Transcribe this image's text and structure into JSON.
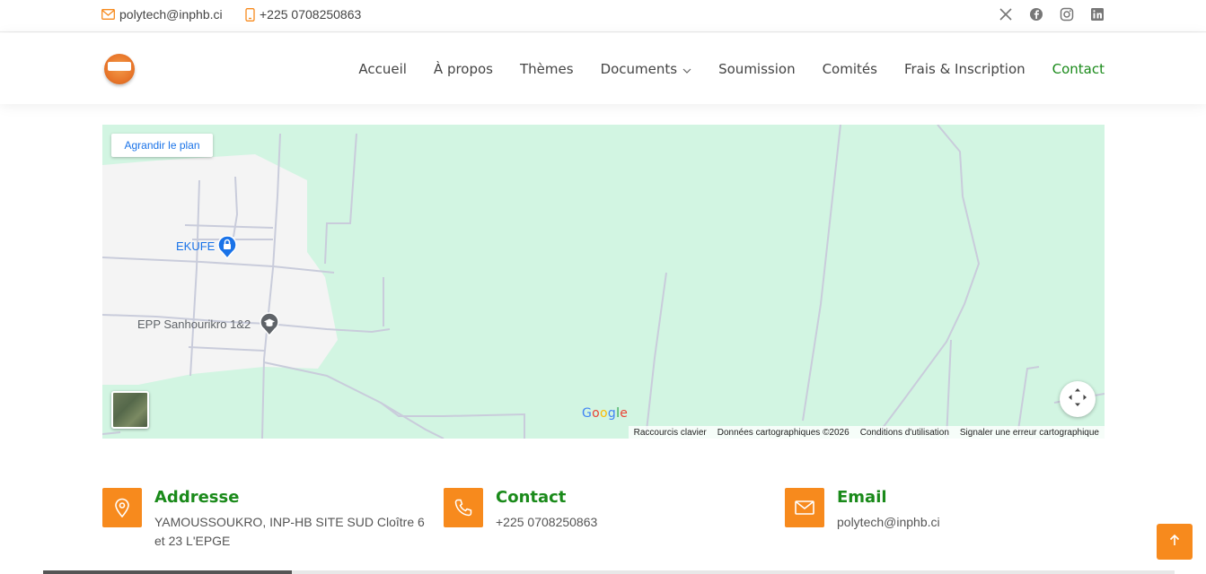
{
  "topbar": {
    "email": "polytech@inphb.ci",
    "phone": "+225 0708250863",
    "email_icon": "envelope-icon",
    "phone_icon": "phone-icon",
    "socials": [
      "x-twitter-icon",
      "facebook-icon",
      "instagram-icon",
      "linkedin-icon"
    ]
  },
  "header": {
    "logo_icon": "conference-logo-icon",
    "nav": [
      {
        "label": "Accueil"
      },
      {
        "label": "À propos"
      },
      {
        "label": "Thèmes"
      },
      {
        "label": "Documents"
      },
      {
        "label": "Soumission"
      },
      {
        "label": "Comités"
      },
      {
        "label": "Frais & Inscription"
      },
      {
        "label": "Contact"
      }
    ],
    "active_color": "#1a8a1a"
  },
  "map": {
    "enlarge_label": "Agrandir le plan",
    "places": [
      {
        "label": "EKUFE",
        "icon": "lock-pin-icon",
        "color": "#1a73e8"
      },
      {
        "label": "EPP Sanhourikro 1&2",
        "icon": "school-pin-icon",
        "color": "#5f6368"
      }
    ],
    "google_label": "Google",
    "attribution": [
      "Raccourcis clavier",
      "Données cartographiques ©2026",
      "Conditions d'utilisation",
      "Signaler une erreur cartographique"
    ]
  },
  "info": {
    "address": {
      "title": "Addresse",
      "text": "YAMOUSSOUKRO, INP-HB SITE SUD Cloître 6 et 23 L'EPGE",
      "icon": "location-pin-icon"
    },
    "contact": {
      "title": "Contact",
      "text": "+225 0708250863",
      "icon": "phone-icon"
    },
    "email": {
      "title": "Email",
      "text": "polytech@inphb.ci",
      "icon": "envelope-icon"
    }
  },
  "colors": {
    "accent": "#f78a1d",
    "heading_green": "#1a8a1a",
    "map_bg": "#d2f5e2"
  }
}
